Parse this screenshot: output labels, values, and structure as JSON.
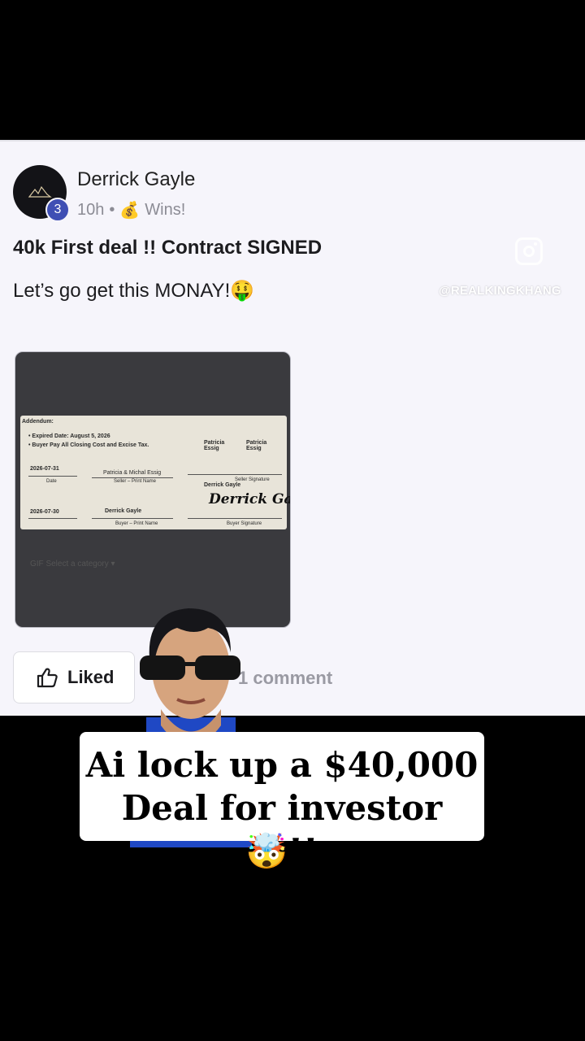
{
  "post": {
    "author": "Derrick Gayle",
    "level": "3",
    "time": "10h",
    "separator": "•",
    "category_icon": "💰",
    "category": "Wins!",
    "title": "40k First deal !! Contract SIGNED",
    "body": "Let’s go get this MONAY!🤑",
    "watermark": "@REALKINGKHANG",
    "like_label": "Liked",
    "comments": "1 comment"
  },
  "document": {
    "heading": "Addendum:",
    "bullet1": "•  Expired Date: August 5, 2026",
    "bullet2": "•  Buyer Pay All Closing Cost and Excise Tax.",
    "seller1": "Patricia Essig",
    "seller2": "Patricia Essig",
    "date1": "2026-07-31",
    "date_label": "Date",
    "seller_print": "Patricia & Michal Essig",
    "seller_print_label": "Seller – Print Name",
    "seller_sig_label": "Seller Signature",
    "buyer_name_top": "Derrick Gayle",
    "date2": "2026-07-30",
    "buyer_print": "Derrick Gayle",
    "buyer_print_label": "Buyer – Print Name",
    "buyer_sig_label": "Buyer Signature",
    "signature": "Derrick Gayle",
    "toolbar": "GIF   Select a category ▾"
  },
  "caption": {
    "line1": "Ai lock up a $40,000",
    "line2": "Deal for investor 🤯!!"
  },
  "colors": {
    "badge": "#3f4fb4",
    "background": "#f6f5fb"
  }
}
